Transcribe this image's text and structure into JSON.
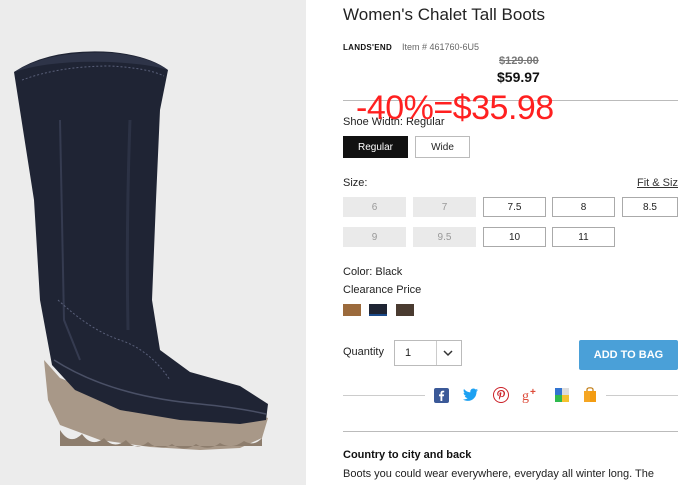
{
  "product": {
    "title": "Women's Chalet Tall Boots",
    "brand": "LANDS'END",
    "item_number": "Item # 461760-6U5",
    "original_price": "$129.00",
    "sale_price": "$59.97",
    "promo_overlay": "-40%=$35.98"
  },
  "shoe_width": {
    "label": "Shoe Width: Regular",
    "options": [
      {
        "label": "Regular",
        "selected": true
      },
      {
        "label": "Wide",
        "selected": false
      }
    ]
  },
  "size": {
    "label": "Size:",
    "fit_link": "Fit & Size",
    "options": [
      {
        "label": "6",
        "available": false
      },
      {
        "label": "7",
        "available": false
      },
      {
        "label": "7.5",
        "available": true
      },
      {
        "label": "8",
        "available": true
      },
      {
        "label": "8.5",
        "available": true
      },
      {
        "label": "9",
        "available": false
      },
      {
        "label": "9.5",
        "available": false
      },
      {
        "label": "10",
        "available": true
      },
      {
        "label": "11",
        "available": true
      }
    ]
  },
  "color": {
    "label": "Color: Black",
    "price_note": "Clearance Price",
    "swatches": [
      {
        "name": "brown",
        "hex": "#9b6a3c",
        "selected": false
      },
      {
        "name": "black",
        "hex": "#1e2433",
        "selected": true
      },
      {
        "name": "dark-brown",
        "hex": "#4a3b30",
        "selected": false
      }
    ]
  },
  "quantity": {
    "label": "Quantity",
    "value": "1"
  },
  "add_to_bag": "ADD TO BAG",
  "share_icons": [
    "facebook-icon",
    "twitter-icon",
    "pinterest-icon",
    "google-plus-icon",
    "delicious-icon",
    "shopping-bag-icon"
  ],
  "description": {
    "heading": "Country to city and back",
    "body": "Boots you could wear everywhere, everyday all winter long. The"
  },
  "colors": {
    "accent": "#4aa0d8",
    "promo": "#ff2020",
    "selected_button": "#111111"
  }
}
